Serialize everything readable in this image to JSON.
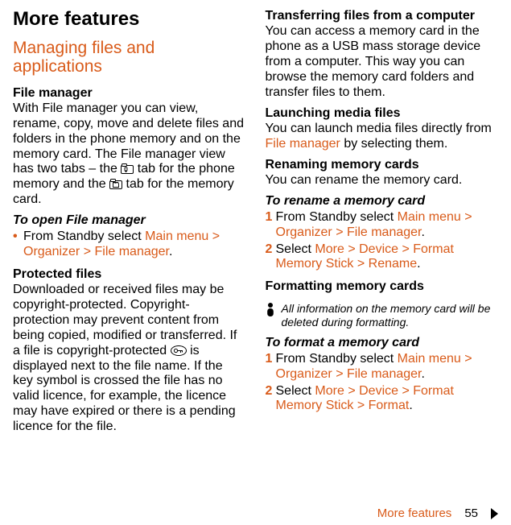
{
  "left": {
    "h1": "More features",
    "h2": "Managing files and applications",
    "fileMgrHead": "File manager",
    "fileMgrBody1": "With File manager you can view, rename, copy, move and delete files and folders in the phone memory and on the memory card. The File manager view has two tabs – the ",
    "fileMgrBody2": " tab for the phone memory and the ",
    "fileMgrBody3": " tab for the memory card.",
    "openHead": "To open File manager",
    "openStepPre": "From Standby select ",
    "openStepPath": "Main menu > Organizer > File manager",
    "protectedHead": "Protected files",
    "protectedBody1": "Downloaded or received files may be copyright-protected. Copyright-protection may prevent content from being copied, modified or transferred. If a file is copyright-protected ",
    "protectedBody2": " is displayed next to the file name. If the key symbol is crossed the file has no valid licence, for example, the licence may have expired or there is a pending licence for the file."
  },
  "right": {
    "transferHead": "Transferring files from a computer",
    "transferBody": "You can access a memory card in the phone as a USB mass storage device from a computer. This way you can browse the memory card folders and transfer files to them.",
    "launchHead": "Launching media files",
    "launchPre": "You can launch media files directly from ",
    "launchPath": "File manager",
    "launchPost": " by selecting them.",
    "renameHead": "Renaming memory cards",
    "renameBody": "You can rename the memory card.",
    "toRenameHead": "To rename a memory card",
    "step1Pre": "From Standby select ",
    "step1Path": "Main menu > Organizer > File manager",
    "step2Pre": "Select ",
    "step2Path": "More > Device > Format Memory Stick > Rename",
    "formatHead": "Formatting memory cards",
    "note": "All information on the memory card will be deleted during formatting.",
    "toFormatHead": "To format a memory card",
    "fstep1Pre": "From Standby select ",
    "fstep1Path": "Main menu > Organizer > File manager",
    "fstep2Pre": "Select ",
    "fstep2Path": "More > Device > Format Memory Stick > Format"
  },
  "footer": {
    "label": "More features",
    "page": "55"
  },
  "icons": {
    "phoneTab": "phone-memory-tab-icon",
    "cardTab": "memory-card-tab-icon",
    "key": "key-icon",
    "note": "info-icon"
  }
}
